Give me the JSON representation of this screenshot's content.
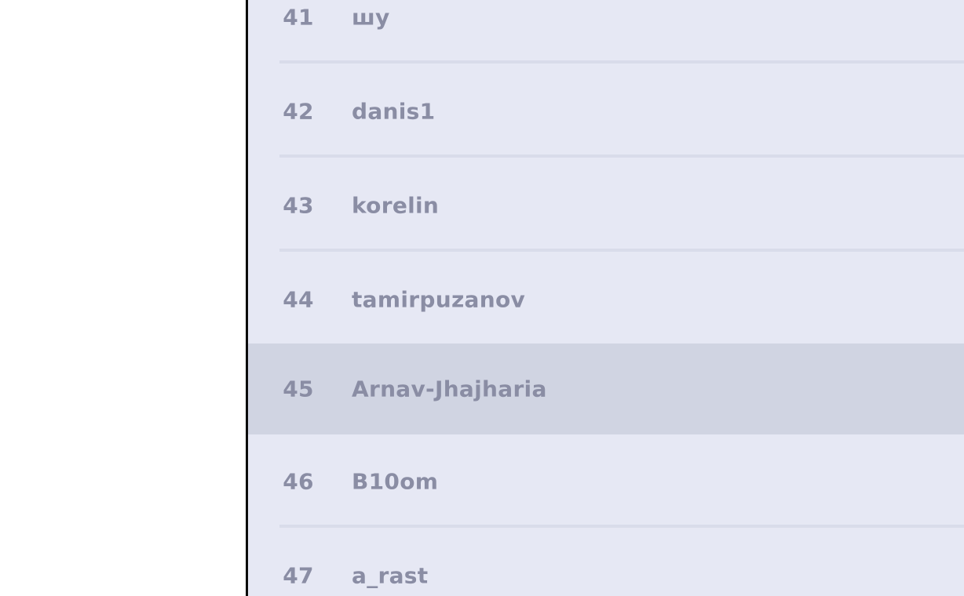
{
  "leaderboard": {
    "rows": [
      {
        "rank": "41",
        "username": "шу"
      },
      {
        "rank": "42",
        "username": "danis1"
      },
      {
        "rank": "43",
        "username": "korelin"
      },
      {
        "rank": "44",
        "username": "tamirpuzanov"
      },
      {
        "rank": "45",
        "username": "Arnav-Jhajharia"
      },
      {
        "rank": "46",
        "username": "B10om"
      },
      {
        "rank": "47",
        "username": "a_rast"
      }
    ],
    "highlighted_rank": "45"
  },
  "colors": {
    "list_bg": "#e6e8f4",
    "highlight_bg": "#d0d4e2",
    "text": "#8a8da4",
    "separator": "#d9dcea"
  }
}
